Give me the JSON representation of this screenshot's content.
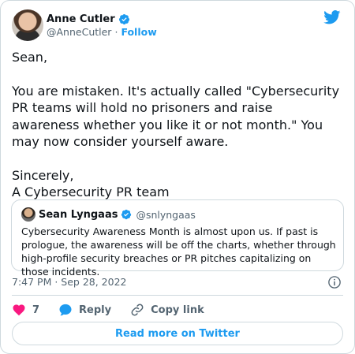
{
  "author": {
    "name": "Anne Cutler",
    "handle": "@AnneCutler",
    "separator": "·",
    "follow_label": "Follow"
  },
  "tweet": {
    "lines": [
      "Sean,",
      "You are mistaken.  It's actually called \"Cybersecurity PR teams will hold no prisoners and raise awareness whether you like it or not month.\"  You may now consider yourself aware.",
      "Sincerely,",
      "A Cybersecurity PR team"
    ]
  },
  "quote": {
    "name": "Sean Lyngaas",
    "handle": "@snlyngaas",
    "text": "Cybersecurity Awareness Month is almost upon us. If past is prologue, the awareness will be off the charts, whether through high-profile security breaches or PR pitches capitalizing on those incidents."
  },
  "meta": {
    "timestamp": "7:47 PM · Sep 28, 2022"
  },
  "actions": {
    "like_count": "7",
    "reply_label": "Reply",
    "copy_label": "Copy link"
  },
  "read_more_label": "Read more on Twitter",
  "colors": {
    "accent": "#1d9bf0",
    "like": "#f91880",
    "text": "#0f1419",
    "muted": "#536471",
    "border": "#cfd9de"
  },
  "icons": [
    "verified-badge-icon",
    "twitter-bird-icon",
    "info-icon",
    "heart-icon",
    "reply-bubble-icon",
    "link-icon"
  ]
}
